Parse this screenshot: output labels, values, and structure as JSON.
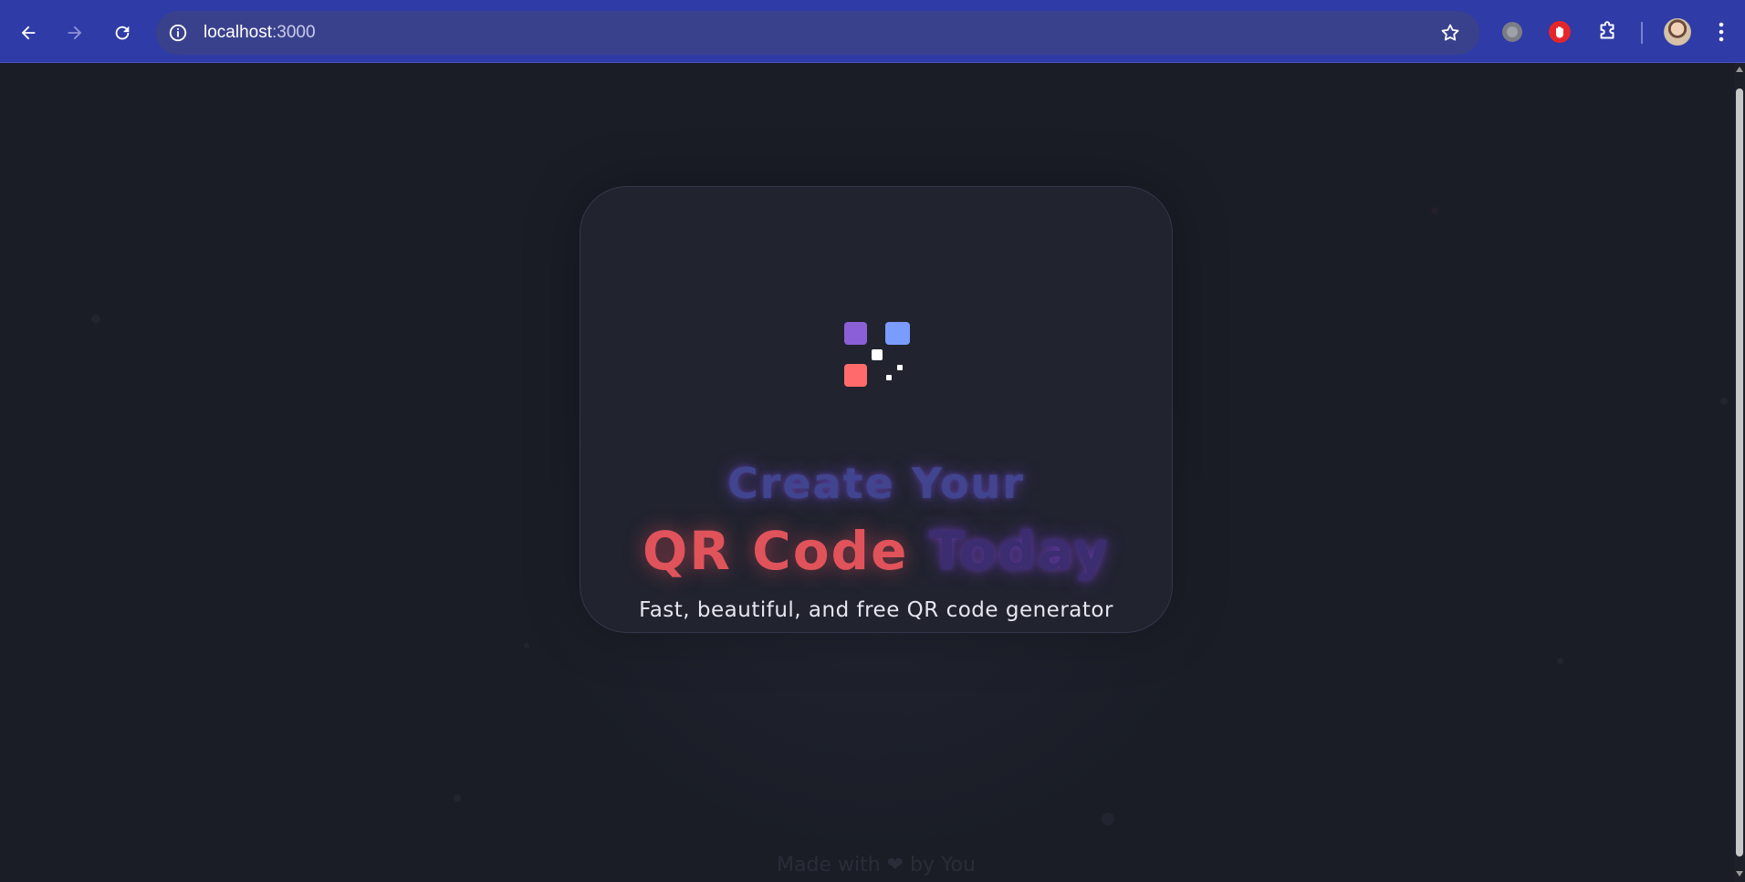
{
  "browser": {
    "url_host": "localhost",
    "url_port": ":3000",
    "back_icon": "arrow-left-icon",
    "forward_icon": "arrow-right-icon",
    "reload_icon": "reload-icon",
    "info_icon": "info-icon",
    "bookmark_icon": "star-icon",
    "extensions": [
      "circle-extension-icon",
      "stop-hand-extension-icon",
      "puzzle-icon"
    ],
    "menu_icon": "vertical-dots-icon",
    "accent_color": "#2f3ba6"
  },
  "hero": {
    "line1": "Create Your",
    "line2_highlight": "QR Code",
    "line2_rest": "Today",
    "subtitle": "Fast, beautiful, and free QR code generator",
    "colors": {
      "purple": "#8b5fd6",
      "blue": "#7b9cff",
      "coral": "#ff6b6b",
      "heading_red": "#e0535a",
      "heading_indigo": "#41458f"
    }
  },
  "footer": {
    "text": "Made with ❤ by You"
  }
}
